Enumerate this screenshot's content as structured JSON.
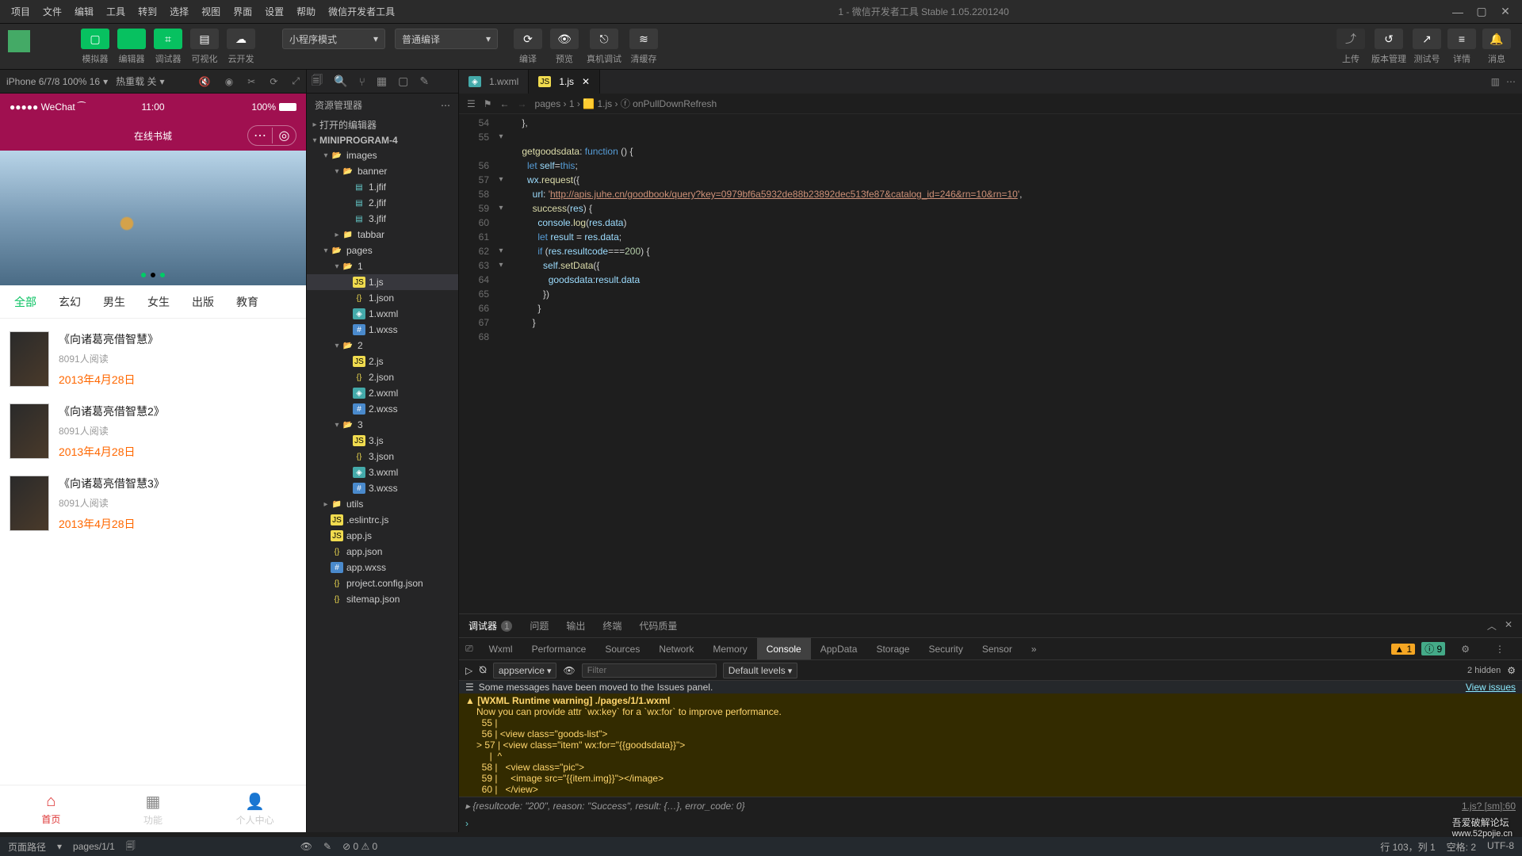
{
  "menubar": [
    "项目",
    "文件",
    "编辑",
    "工具",
    "转到",
    "选择",
    "视图",
    "界面",
    "设置",
    "帮助",
    "微信开发者工具"
  ],
  "window_title": "1 - 微信开发者工具 Stable 1.05.2201240",
  "toolbar": {
    "main_buttons": [
      {
        "icon": "▢",
        "label": "模拟器",
        "green": true
      },
      {
        "icon": "</>",
        "label": "编辑器",
        "green": true
      },
      {
        "icon": "⌗",
        "label": "调试器",
        "green": true
      },
      {
        "icon": "▤",
        "label": "可视化",
        "green": false
      },
      {
        "icon": "☁",
        "label": "云开发",
        "green": false
      }
    ],
    "mode_select": "小程序模式",
    "compile_select": "普通编译",
    "compile_buttons": [
      {
        "icon": "⟳",
        "label": "编译"
      },
      {
        "icon": "👁",
        "label": "预览"
      },
      {
        "icon": "⎋",
        "label": "真机调试"
      },
      {
        "icon": "≋",
        "label": "清缓存"
      }
    ],
    "right_buttons": [
      {
        "icon": "⤴",
        "label": "上传",
        "dim": true
      },
      {
        "icon": "↺",
        "label": "版本管理"
      },
      {
        "icon": "↗",
        "label": "测试号"
      },
      {
        "icon": "≡",
        "label": "详情"
      },
      {
        "icon": "🔔",
        "label": "消息"
      }
    ]
  },
  "simulator": {
    "device": "iPhone 6/7/8 100% 16",
    "hot_reload": "热重载 关",
    "status": {
      "left": "●●●●● WeChat ⁀",
      "time": "11:00",
      "battery": "100%"
    },
    "nav_title": "在线书城",
    "categories": [
      "全部",
      "玄幻",
      "男生",
      "女生",
      "出版",
      "教育"
    ],
    "books": [
      {
        "title": "《向诸葛亮借智慧》",
        "reads": "8091人阅读",
        "date": "2013年4月28日"
      },
      {
        "title": "《向诸葛亮借智慧2》",
        "reads": "8091人阅读",
        "date": "2013年4月28日"
      },
      {
        "title": "《向诸葛亮借智慧3》",
        "reads": "8091人阅读",
        "date": "2013年4月28日"
      }
    ],
    "tabs": [
      {
        "icon": "⌂",
        "label": "首页",
        "active": true
      },
      {
        "icon": "▦",
        "label": "功能"
      },
      {
        "icon": "👤",
        "label": "个人中心"
      }
    ]
  },
  "explorer": {
    "title": "资源管理器",
    "sections": {
      "open_editors": "打开的编辑器",
      "project": "MINIPROGRAM-4"
    },
    "tree": [
      {
        "d": 1,
        "t": "folder-open",
        "n": "images",
        "arrow": "▾"
      },
      {
        "d": 2,
        "t": "folder-open",
        "n": "banner",
        "arrow": "▾"
      },
      {
        "d": 3,
        "t": "img",
        "n": "1.jfif"
      },
      {
        "d": 3,
        "t": "img",
        "n": "2.jfif"
      },
      {
        "d": 3,
        "t": "img",
        "n": "3.jfif"
      },
      {
        "d": 2,
        "t": "folder",
        "n": "tabbar",
        "arrow": "▸"
      },
      {
        "d": 1,
        "t": "folder-open",
        "n": "pages",
        "arrow": "▾"
      },
      {
        "d": 2,
        "t": "folder-open",
        "n": "1",
        "arrow": "▾"
      },
      {
        "d": 3,
        "t": "js",
        "n": "1.js",
        "active": true
      },
      {
        "d": 3,
        "t": "json",
        "n": "1.json"
      },
      {
        "d": 3,
        "t": "wxml",
        "n": "1.wxml"
      },
      {
        "d": 3,
        "t": "wxss",
        "n": "1.wxss"
      },
      {
        "d": 2,
        "t": "folder-open",
        "n": "2",
        "arrow": "▾"
      },
      {
        "d": 3,
        "t": "js",
        "n": "2.js"
      },
      {
        "d": 3,
        "t": "json",
        "n": "2.json"
      },
      {
        "d": 3,
        "t": "wxml",
        "n": "2.wxml"
      },
      {
        "d": 3,
        "t": "wxss",
        "n": "2.wxss"
      },
      {
        "d": 2,
        "t": "folder-open",
        "n": "3",
        "arrow": "▾"
      },
      {
        "d": 3,
        "t": "js",
        "n": "3.js"
      },
      {
        "d": 3,
        "t": "json",
        "n": "3.json"
      },
      {
        "d": 3,
        "t": "wxml",
        "n": "3.wxml"
      },
      {
        "d": 3,
        "t": "wxss",
        "n": "3.wxss"
      },
      {
        "d": 1,
        "t": "folder",
        "n": "utils",
        "arrow": "▸"
      },
      {
        "d": 1,
        "t": "js",
        "n": ".eslintrc.js"
      },
      {
        "d": 1,
        "t": "js",
        "n": "app.js"
      },
      {
        "d": 1,
        "t": "json",
        "n": "app.json"
      },
      {
        "d": 1,
        "t": "wxss",
        "n": "app.wxss"
      },
      {
        "d": 1,
        "t": "json",
        "n": "project.config.json"
      },
      {
        "d": 1,
        "t": "json",
        "n": "sitemap.json"
      }
    ]
  },
  "editor": {
    "tabs": [
      {
        "name": "1.wxml",
        "icon": "wxml"
      },
      {
        "name": "1.js",
        "icon": "js",
        "active": true,
        "close": true
      }
    ],
    "crumbs": "pages › 1 › 🟨 1.js › ⓕ onPullDownRefresh",
    "lines": [
      {
        "n": 54,
        "c": "    },"
      },
      {
        "n": 55,
        "c": "",
        "fold": "▾"
      },
      {
        "n": "",
        "c": "    <span class='k-yel'>getgoodsdata</span>: <span class='k-blue'>function</span> () {"
      },
      {
        "n": 56,
        "c": "      <span class='k-blue'>let</span> <span class='k-obj'>self</span>=<span class='k-blue'>this</span>;"
      },
      {
        "n": 57,
        "c": "      <span class='k-obj'>wx</span>.<span class='k-yel'>request</span>({",
        "fold": "▾"
      },
      {
        "n": 58,
        "c": "        <span class='k-obj'>url</span>: <span class='k-str'>'</span><span class='k-url'>http://apis.juhe.cn/goodbook/query?key=0979bf6a5932de88b23892dec513fe87&catalog_id=246&rn=10&rn=10</span><span class='k-str'>'</span>,"
      },
      {
        "n": 59,
        "c": "        <span class='k-yel'>success</span>(<span class='k-obj'>res</span>) {",
        "fold": "▾"
      },
      {
        "n": 60,
        "c": "          <span class='k-obj'>console</span>.<span class='k-yel'>log</span>(<span class='k-obj'>res</span>.<span class='k-obj'>data</span>)"
      },
      {
        "n": 61,
        "c": "          <span class='k-blue'>let</span> <span class='k-obj'>result</span> = <span class='k-obj'>res</span>.<span class='k-obj'>data</span>;"
      },
      {
        "n": 62,
        "c": "          <span class='k-blue'>if</span> (<span class='k-obj'>res</span>.<span class='k-obj'>resultcode</span>===<span class='k-num'>200</span>) {",
        "fold": "▾"
      },
      {
        "n": 63,
        "c": "            <span class='k-obj'>self</span>.<span class='k-yel'>setData</span>({",
        "fold": "▾"
      },
      {
        "n": 64,
        "c": "              <span class='k-obj'>goodsdata</span>:<span class='k-obj'>result</span>.<span class='k-obj'>data</span>"
      },
      {
        "n": 65,
        "c": "            })"
      },
      {
        "n": 66,
        "c": "          }"
      },
      {
        "n": 67,
        "c": "        }"
      },
      {
        "n": 68,
        "c": ""
      }
    ]
  },
  "panel": {
    "tabs": [
      "调试器",
      "问题",
      "输出",
      "终端",
      "代码质量"
    ],
    "badge": "1",
    "devtools_tabs": [
      "Wxml",
      "Performance",
      "Sources",
      "Network",
      "Memory",
      "Console",
      "AppData",
      "Storage",
      "Security",
      "Sensor"
    ],
    "warn_count": "1",
    "info_count": "9",
    "context": "appservice",
    "filter_ph": "Filter",
    "levels": "Default levels",
    "hidden": "2 hidden",
    "messages": {
      "moved": "Some messages have been moved to the Issues panel.",
      "view_link": "View issues",
      "warn_head": "[WXML Runtime warning] ./pages/1/1.wxml",
      "warn_body": "Now you can provide attr `wx:key` for a `wx:for` to improve performance.",
      "snippet": [
        "  55 |",
        "  56 | <view class=\"goods-list\">",
        "> 57 | <view class=\"item\" wx:for=\"{{goodsdata}}\">",
        "     |  ^",
        "  58 |   <view class=\"pic\">",
        "  59 |     <image src=\"{{item.img}}\"></image>",
        "  60 |   </view>"
      ],
      "result": "▸ {resultcode: \"200\", reason: \"Success\", result: {…}, error_code: 0}",
      "result_src": "1.js? [sm]:60"
    }
  },
  "statusbar": {
    "path_lbl": "页面路径",
    "path": "pages/1/1",
    "warn": "⊘ 0 ⚠ 0",
    "pos": "行 103，列 1",
    "spaces": "空格: 2",
    "enc": "UTF-8"
  },
  "watermark": {
    "l1": "吾爱破解论坛",
    "l2": "www.52pojie.cn"
  }
}
